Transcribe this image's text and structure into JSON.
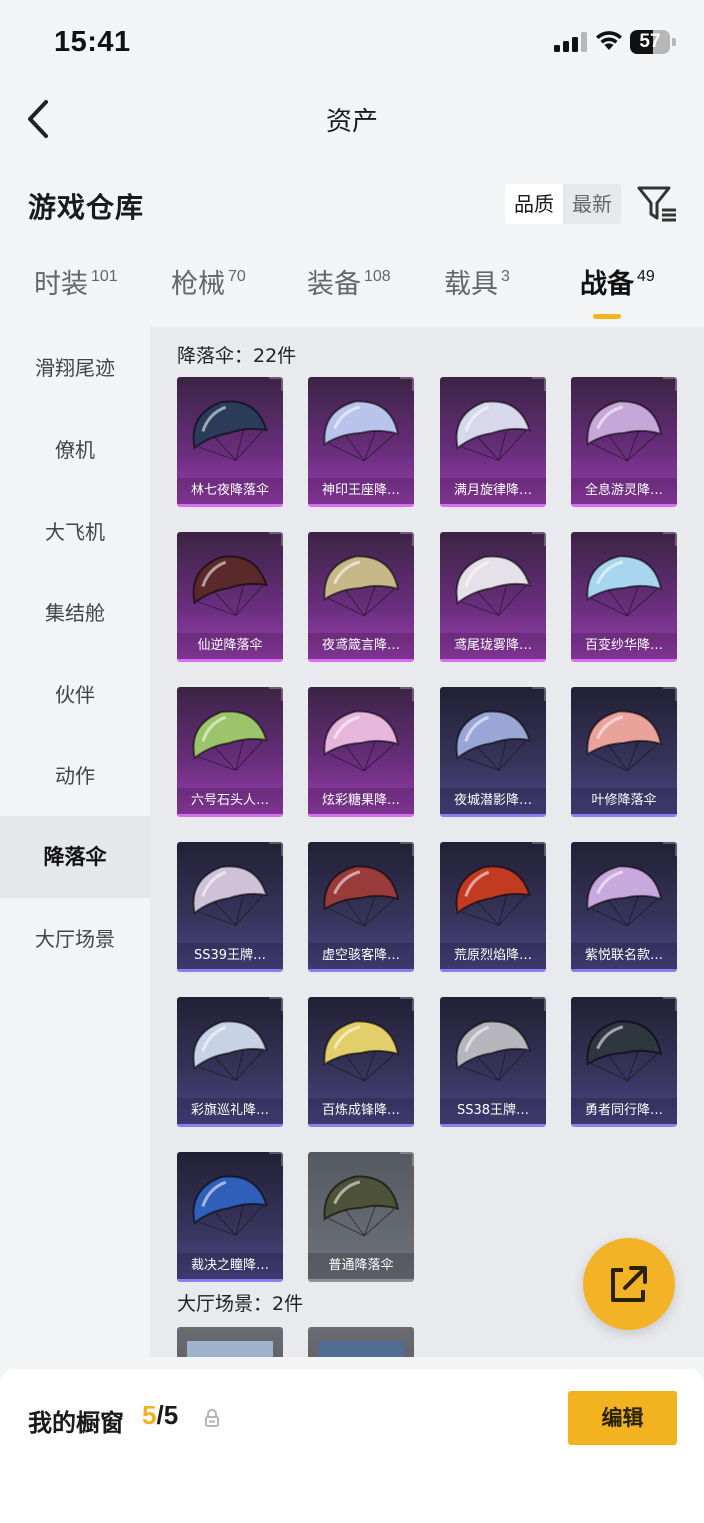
{
  "status_bar": {
    "time": "15:41",
    "battery": "57",
    "battery_level": 0.57
  },
  "nav": {
    "title": "资产"
  },
  "header": {
    "title": "游戏仓库",
    "sort_options": [
      "品质",
      "最新"
    ],
    "sort_selected": "品质"
  },
  "tabs": [
    {
      "label": "时装",
      "count": "101"
    },
    {
      "label": "枪械",
      "count": "70"
    },
    {
      "label": "装备",
      "count": "108"
    },
    {
      "label": "载具",
      "count": "3"
    },
    {
      "label": "战备",
      "count": "49",
      "active": true
    }
  ],
  "sidebar": {
    "items": [
      "滑翔尾迹",
      "僚机",
      "大飞机",
      "集结舱",
      "伙伴",
      "动作",
      "降落伞",
      "大厅场景"
    ],
    "active": "降落伞"
  },
  "groups": [
    {
      "label": "降落伞：22件",
      "items": [
        {
          "name": "林七夜降落伞",
          "rarity": "purple",
          "color": "#2b3b5a"
        },
        {
          "name": "神印王座降…",
          "rarity": "purple",
          "color": "#b9c4ea"
        },
        {
          "name": "满月旋律降…",
          "rarity": "purple",
          "color": "#d8d8ec"
        },
        {
          "name": "全息游灵降…",
          "rarity": "purple",
          "color": "#c7a7d9"
        },
        {
          "name": "仙逆降落伞",
          "rarity": "purple",
          "color": "#5a2a2a"
        },
        {
          "name": "夜鸢箴言降…",
          "rarity": "purple",
          "color": "#c7b88a"
        },
        {
          "name": "鸢尾珑雾降…",
          "rarity": "purple",
          "color": "#e6e0e8"
        },
        {
          "name": "百变纱华降…",
          "rarity": "purple",
          "color": "#a9d6ef"
        },
        {
          "name": "六号石头人…",
          "rarity": "purple",
          "color": "#9cc46a"
        },
        {
          "name": "炫彩糖果降…",
          "rarity": "purple",
          "color": "#e7b6dc"
        },
        {
          "name": "夜城潜影降…",
          "rarity": "blue",
          "color": "#9aa6d6"
        },
        {
          "name": "叶修降落伞",
          "rarity": "blue",
          "color": "#e9a39a"
        },
        {
          "name": "SS39王牌…",
          "rarity": "blue",
          "color": "#cfc2d8"
        },
        {
          "name": "虚空骇客降…",
          "rarity": "blue",
          "color": "#9a3b3b"
        },
        {
          "name": "荒原烈焰降…",
          "rarity": "blue",
          "color": "#c23a22"
        },
        {
          "name": "紫悦联名款…",
          "rarity": "blue",
          "color": "#c9a9dd"
        },
        {
          "name": "彩旗巡礼降…",
          "rarity": "blue",
          "color": "#c8d2e6"
        },
        {
          "name": "百炼成锋降…",
          "rarity": "blue",
          "color": "#e2cf6a"
        },
        {
          "name": "SS38王牌…",
          "rarity": "blue",
          "color": "#b6b6bc"
        },
        {
          "name": "勇者同行降…",
          "rarity": "blue",
          "color": "#2e3640"
        },
        {
          "name": "裁决之瞳降…",
          "rarity": "blue",
          "color": "#2f5fb8"
        },
        {
          "name": "普通降落伞",
          "rarity": "gray",
          "color": "#4d5238"
        }
      ]
    },
    {
      "label": "大厅场景：2件",
      "items": [
        {
          "name": "",
          "rarity": "scene",
          "color": "#9fb4cc"
        },
        {
          "name": "",
          "rarity": "scene",
          "color": "#4f6e92"
        }
      ]
    }
  ],
  "showcase": {
    "title": "我的橱窗",
    "current": "5",
    "total": "/5",
    "edit_label": "编辑"
  },
  "icons": {
    "back": "chevron-left-icon",
    "filter": "filter-icon",
    "share": "share-icon",
    "lock": "lock-icon"
  }
}
